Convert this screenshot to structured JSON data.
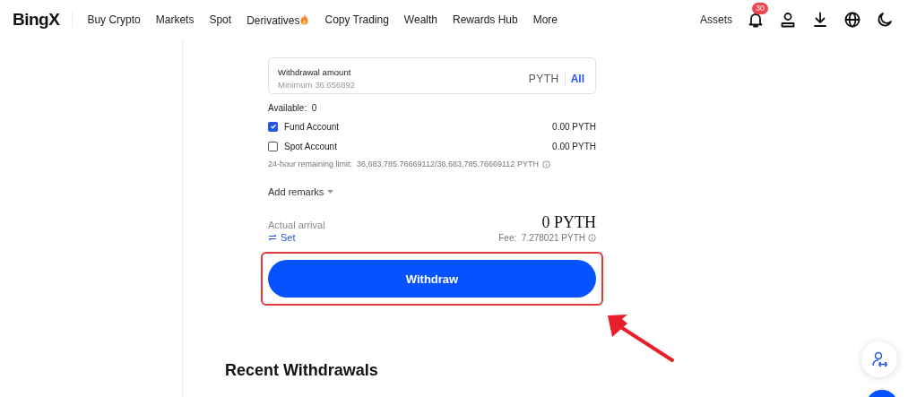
{
  "header": {
    "logo": "BingX",
    "nav": [
      {
        "label": "Buy Crypto",
        "hot": false
      },
      {
        "label": "Markets",
        "hot": false
      },
      {
        "label": "Spot",
        "hot": false
      },
      {
        "label": "Derivatives",
        "hot": true
      },
      {
        "label": "Copy Trading",
        "hot": false
      },
      {
        "label": "Wealth",
        "hot": false
      },
      {
        "label": "Rewards Hub",
        "hot": false
      },
      {
        "label": "More",
        "hot": false
      }
    ],
    "assets": "Assets",
    "notification_count": "30"
  },
  "withdrawal": {
    "amount_field": {
      "label": "Withdrawal amount",
      "placeholder": "Minimum 36.656892",
      "unit": "PYTH",
      "all": "All"
    },
    "available": "Available:  0",
    "accounts": [
      {
        "name": "Fund Account",
        "checked": true,
        "balance": "0.00 PYTH"
      },
      {
        "name": "Spot Account",
        "checked": false,
        "balance": "0.00 PYTH"
      }
    ],
    "limit": "24-hour remaining limit:  36,683,785.76669112/36,683,785.76669112 PYTH",
    "remarks": "Add remarks",
    "arrival_label": "Actual arrival",
    "arrival_value": "0 PYTH",
    "set": "Set",
    "fee": "Fee:  7.278021 PYTH",
    "button": "Withdraw",
    "highlighted": true
  },
  "recent_title": "Recent Withdrawals"
}
